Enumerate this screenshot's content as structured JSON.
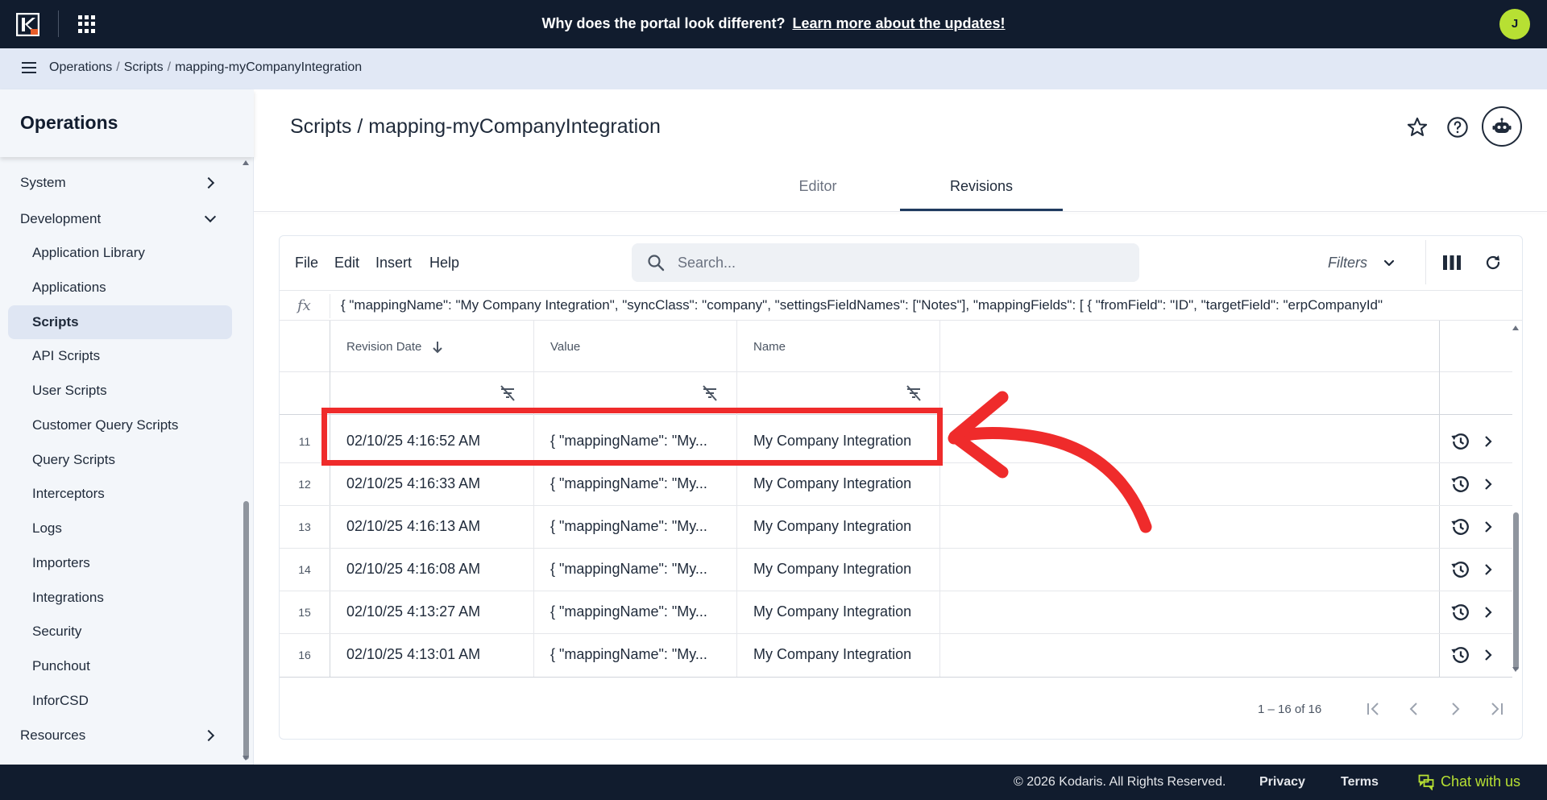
{
  "topbar": {
    "announcement": "Why does the portal look different?",
    "announcement_link": "Learn more about the updates!",
    "avatar_initial": "J"
  },
  "breadcrumb": {
    "items": [
      "Operations",
      "Scripts",
      "mapping-myCompanyIntegration"
    ]
  },
  "sidebar": {
    "title": "Operations",
    "items": [
      {
        "label": "System"
      },
      {
        "label": "Development"
      },
      {
        "label": "Application Library"
      },
      {
        "label": "Applications"
      },
      {
        "label": "Scripts"
      },
      {
        "label": "API Scripts"
      },
      {
        "label": "User Scripts"
      },
      {
        "label": "Customer Query Scripts"
      },
      {
        "label": "Query Scripts"
      },
      {
        "label": "Interceptors"
      },
      {
        "label": "Logs"
      },
      {
        "label": "Importers"
      },
      {
        "label": "Integrations"
      },
      {
        "label": "Security"
      },
      {
        "label": "Punchout"
      },
      {
        "label": "InforCSD"
      },
      {
        "label": "Resources"
      }
    ]
  },
  "main": {
    "title": "Scripts / mapping-myCompanyIntegration",
    "tabs": [
      {
        "label": "Editor"
      },
      {
        "label": "Revisions"
      }
    ]
  },
  "toolbar": {
    "menus": [
      "File",
      "Edit",
      "Insert",
      "Help"
    ],
    "search_placeholder": "Search...",
    "filters_label": "Filters"
  },
  "formula_bar": {
    "fx": "fx",
    "value": "{  \"mappingName\": \"My Company Integration\",  \"syncClass\": \"company\",  \"settingsFieldNames\": [\"Notes\"],  \"mappingFields\": [    {      \"fromField\": \"ID\", \"targetField\": \"erpCompanyId\""
  },
  "table": {
    "columns": [
      {
        "label": "Revision Date"
      },
      {
        "label": "Value"
      },
      {
        "label": "Name"
      }
    ],
    "rows": [
      {
        "num": "11",
        "date": "02/10/25 4:16:52 AM",
        "value": "{ \"mappingName\": \"My...",
        "name": "My Company Integration"
      },
      {
        "num": "12",
        "date": "02/10/25 4:16:33 AM",
        "value": "{ \"mappingName\": \"My...",
        "name": "My Company Integration"
      },
      {
        "num": "13",
        "date": "02/10/25 4:16:13 AM",
        "value": "{ \"mappingName\": \"My...",
        "name": "My Company Integration"
      },
      {
        "num": "14",
        "date": "02/10/25 4:16:08 AM",
        "value": "{ \"mappingName\": \"My...",
        "name": "My Company Integration"
      },
      {
        "num": "15",
        "date": "02/10/25 4:13:27 AM",
        "value": "{ \"mappingName\": \"My...",
        "name": "My Company Integration"
      },
      {
        "num": "16",
        "date": "02/10/25 4:13:01 AM",
        "value": "{ \"mappingName\": \"My...",
        "name": "My Company Integration"
      }
    ],
    "pagination": "1 – 16 of 16"
  },
  "footer": {
    "copyright": "© 2026 Kodaris. All Rights Reserved.",
    "privacy": "Privacy",
    "terms": "Terms",
    "chat": "Chat with us"
  },
  "colors": {
    "navy": "#111c2e",
    "accent_green": "#b7e033",
    "annotation_red": "#ef2b2b"
  }
}
